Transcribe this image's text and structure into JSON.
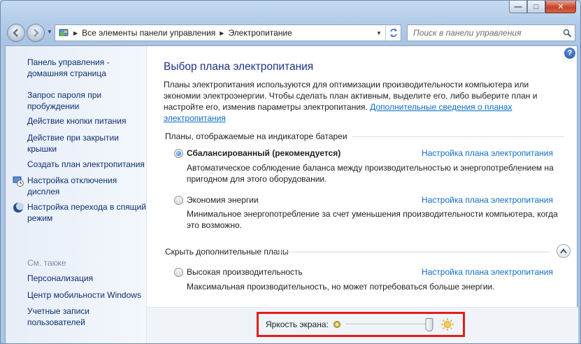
{
  "window": {
    "minimize_glyph": "—",
    "maximize_glyph": "□",
    "close_glyph": "✕"
  },
  "nav": {
    "breadcrumbs": [
      "Все элементы панели управления",
      "Электропитание"
    ],
    "search_placeholder": "Поиск в панели управления"
  },
  "sidebar": {
    "items": [
      {
        "label": "Панель управления - домашняя страница",
        "icon": null
      },
      {
        "label": "Запрос пароля при пробуждении",
        "icon": null
      },
      {
        "label": "Действие кнопки питания",
        "icon": null
      },
      {
        "label": "Действие при закрытии крышки",
        "icon": null
      },
      {
        "label": "Создать план электропитания",
        "icon": null
      },
      {
        "label": "Настройка отключения дисплея",
        "icon": "display-schedule-icon"
      },
      {
        "label": "Настройка перехода в спящий режим",
        "icon": "moon-icon"
      }
    ],
    "see_also_heading": "См. также",
    "see_also": [
      "Персонализация",
      "Центр мобильности Windows",
      "Учетные записи пользователей"
    ]
  },
  "main": {
    "title": "Выбор плана электропитания",
    "intro_text": "Планы электропитания используются для оптимизации производительности компьютера или экономии электроэнергии. Чтобы сделать план активным, выделите его, либо выберите план и настройте его, изменив параметры электропитания. ",
    "intro_link": "Дополнительные сведения о планах электропитания",
    "battery_section_heading": "Планы, отображаемые на индикаторе батареи",
    "hidden_section_heading": "Скрыть дополнительные планы",
    "plans": [
      {
        "name": "Сбалансированный (рекомендуется)",
        "description": "Автоматическое соблюдение баланса между производительностью и энергопотреблением на пригодном для этого оборудовании.",
        "link": "Настройка плана электропитания",
        "selected": true
      },
      {
        "name": "Экономия энергии",
        "description": "Минимальное энергопотребление за счет уменьшения производительности компьютера, когда это возможно.",
        "link": "Настройка плана электропитания",
        "selected": false
      },
      {
        "name": "Высокая производительность",
        "description": "Максимальная производительность, но может потребоваться больше энергии.",
        "link": "Настройка плана электропитания",
        "selected": false
      }
    ],
    "brightness": {
      "label": "Яркость экрана:",
      "level": 1.0
    }
  },
  "colors": {
    "highlight_box": "#e01f1f",
    "link": "#0b6dc7",
    "title": "#1e3287"
  }
}
